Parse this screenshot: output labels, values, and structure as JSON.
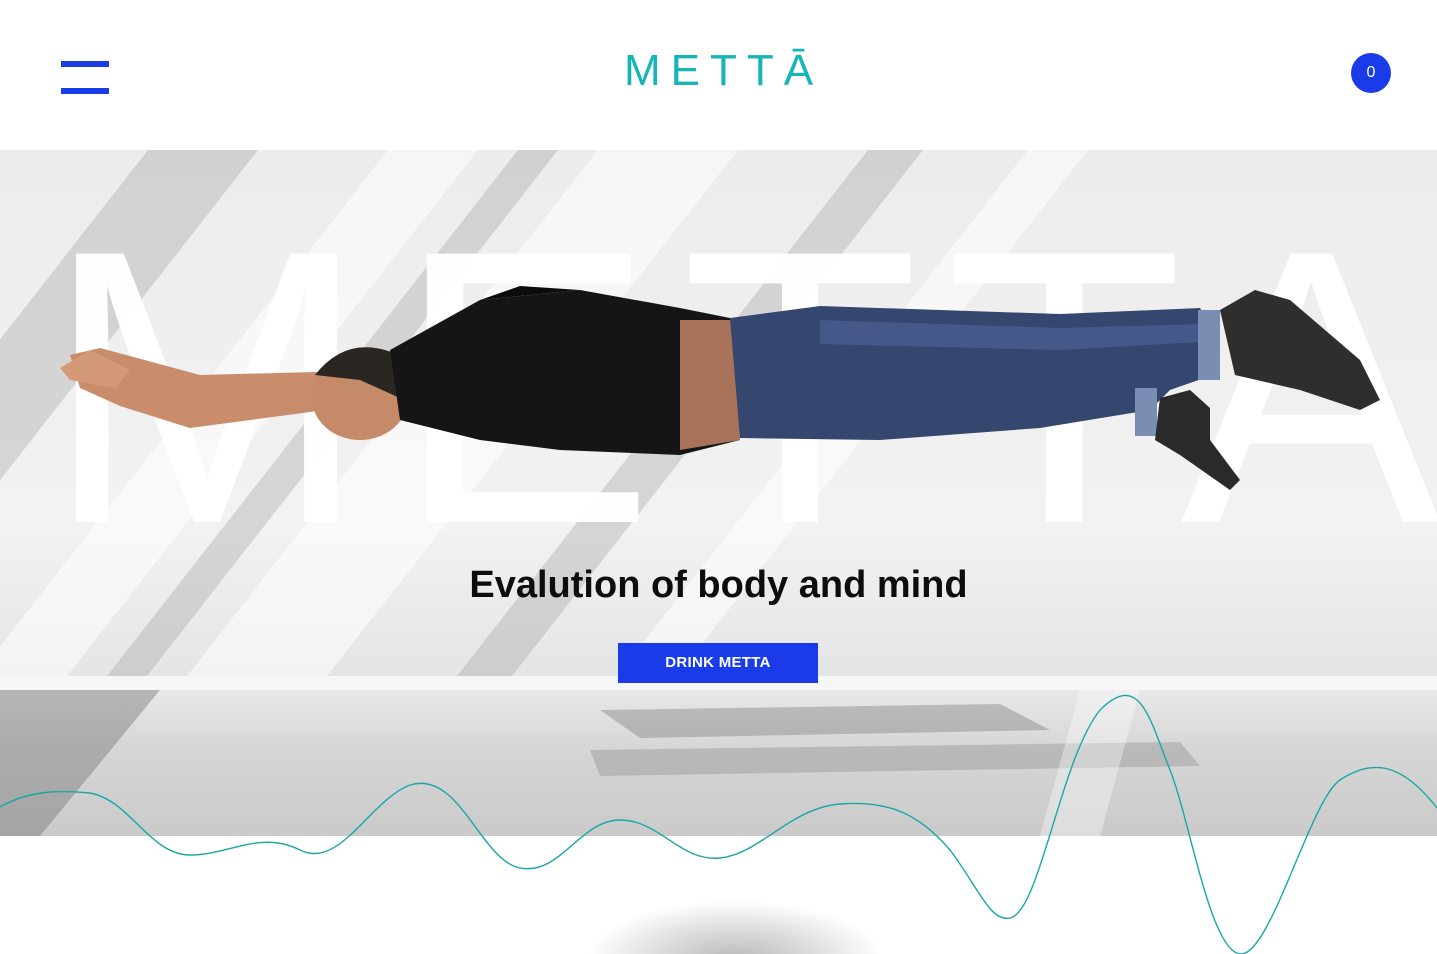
{
  "header": {
    "menu_icon": "hamburger-menu-icon",
    "logo_text": "METTĀ",
    "cart_count": "0"
  },
  "hero": {
    "background_word": "METTA",
    "tagline": "Evalution of body and mind",
    "cta_label": "DRINK METTA"
  },
  "colors": {
    "brand_blue": "#1a3be8",
    "logo_teal": "#17b5b5",
    "wave_teal": "#1aa6a6"
  }
}
